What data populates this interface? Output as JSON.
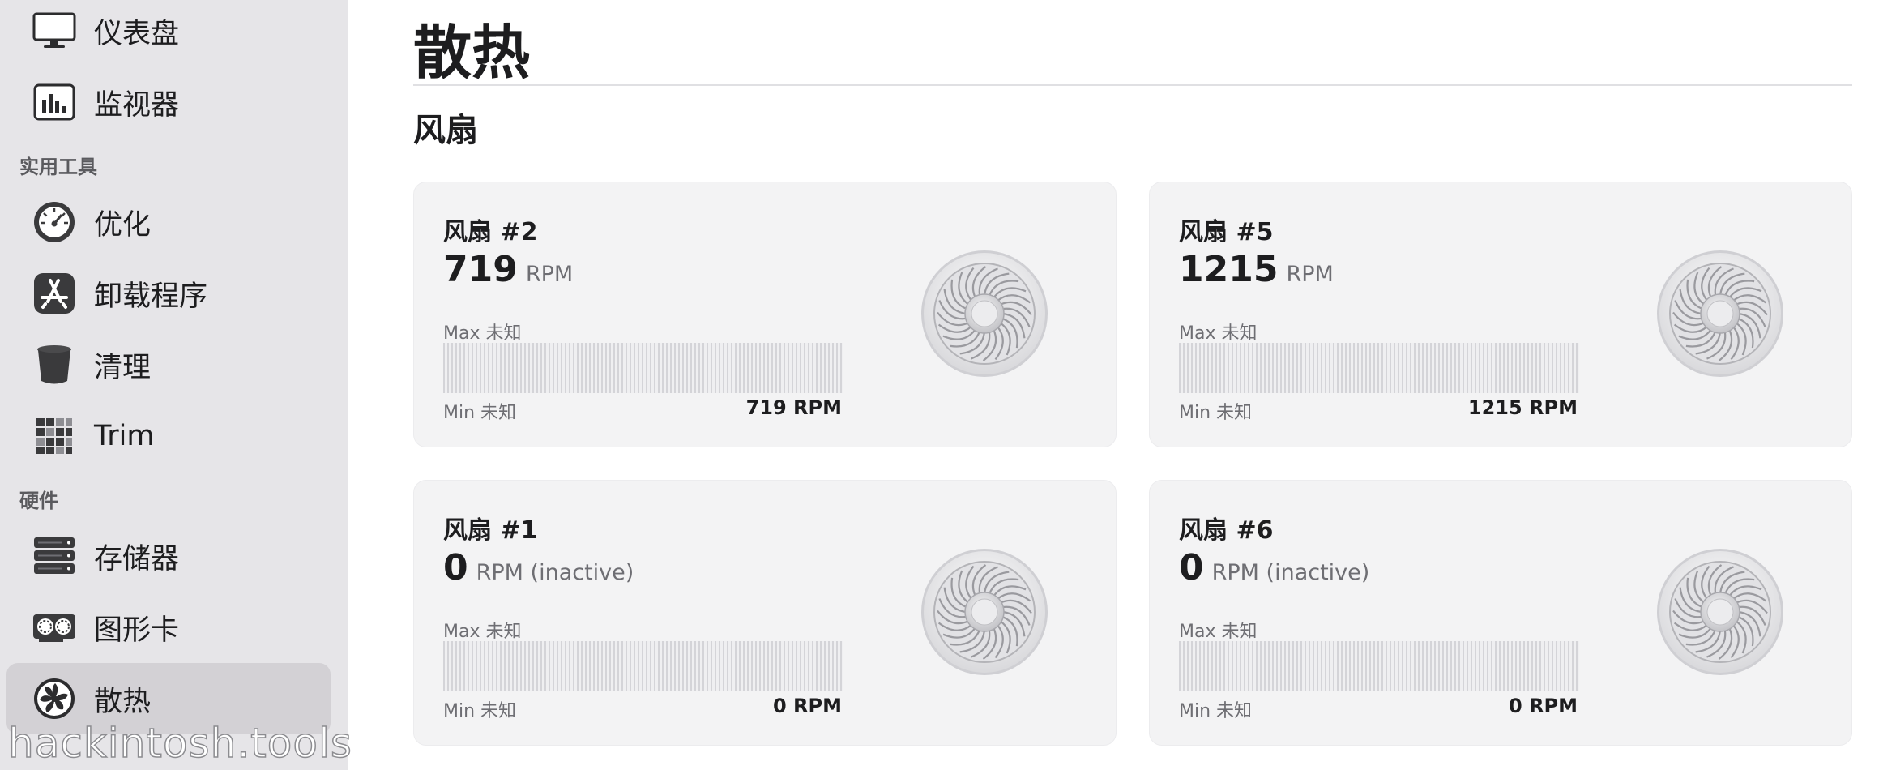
{
  "sidebar": {
    "top_items": [
      {
        "label": "仪表盘",
        "icon": "monitor-icon"
      },
      {
        "label": "监视器",
        "icon": "bar-chart-icon"
      }
    ],
    "utilities_section": "实用工具",
    "utility_items": [
      {
        "label": "优化",
        "icon": "gauge-icon"
      },
      {
        "label": "卸载程序",
        "icon": "app-store-icon"
      },
      {
        "label": "清理",
        "icon": "trash-icon"
      },
      {
        "label": "Trim",
        "icon": "grid-icon"
      }
    ],
    "hardware_section": "硬件",
    "hardware_items": [
      {
        "label": "存储器",
        "icon": "storage-icon"
      },
      {
        "label": "图形卡",
        "icon": "graphics-card-icon"
      },
      {
        "label": "散热",
        "icon": "fan-icon",
        "active": true
      }
    ],
    "watermark": "hackintosh.tools"
  },
  "main": {
    "title": "散热",
    "section": "风扇",
    "fans": [
      {
        "name": "风扇 #2",
        "rpm": "719",
        "unit": "RPM",
        "max": "Max 未知",
        "min": "Min 未知",
        "current": "719 RPM"
      },
      {
        "name": "风扇 #5",
        "rpm": "1215",
        "unit": "RPM",
        "max": "Max 未知",
        "min": "Min 未知",
        "current": "1215 RPM"
      },
      {
        "name": "风扇 #1",
        "rpm": "0",
        "unit": "RPM (inactive)",
        "max": "Max 未知",
        "min": "Min 未知",
        "current": "0 RPM"
      },
      {
        "name": "风扇 #6",
        "rpm": "0",
        "unit": "RPM (inactive)",
        "max": "Max 未知",
        "min": "Min 未知",
        "current": "0 RPM"
      }
    ]
  },
  "colors": {
    "sidebar_bg": "#e6e5e8",
    "active_item_bg": "#d3d1d5",
    "card_bg": "#f3f3f4",
    "text_primary": "#1d1d1f",
    "text_secondary": "#6e6e73"
  }
}
